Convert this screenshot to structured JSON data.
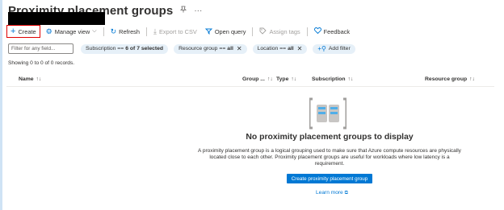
{
  "header": {
    "title": "Proximity placement groups",
    "pin_icon": "pin-icon",
    "more_icon": "more-icon"
  },
  "toolbar": {
    "create": "Create",
    "manage_view": "Manage view",
    "refresh": "Refresh",
    "export_csv": "Export to CSV",
    "open_query": "Open query",
    "assign_tags": "Assign tags",
    "feedback": "Feedback"
  },
  "filters": {
    "placeholder": "Filter for any field...",
    "subscription_label": "Subscription ==",
    "subscription_value": "6 of 7 selected",
    "resource_group_label": "Resource group ==",
    "resource_group_value": "all",
    "location_label": "Location ==",
    "location_value": "all",
    "add_filter": "Add filter"
  },
  "records": "Showing 0 to 0 of 0 records.",
  "table": {
    "columns": [
      "Name",
      "Group ...",
      "Type",
      "Subscription",
      "Resource group"
    ]
  },
  "empty": {
    "title": "No proximity placement groups to display",
    "description": "A proximity placement group is a logical grouping used to make sure that Azure compute resources are physically located close to each other. Proximity placement groups are useful for workloads where low latency is a requirement.",
    "button": "Create proximity placement group",
    "learn_more": "Learn more"
  },
  "colors": {
    "accent": "#0078d4",
    "highlight_border": "#e00000"
  }
}
